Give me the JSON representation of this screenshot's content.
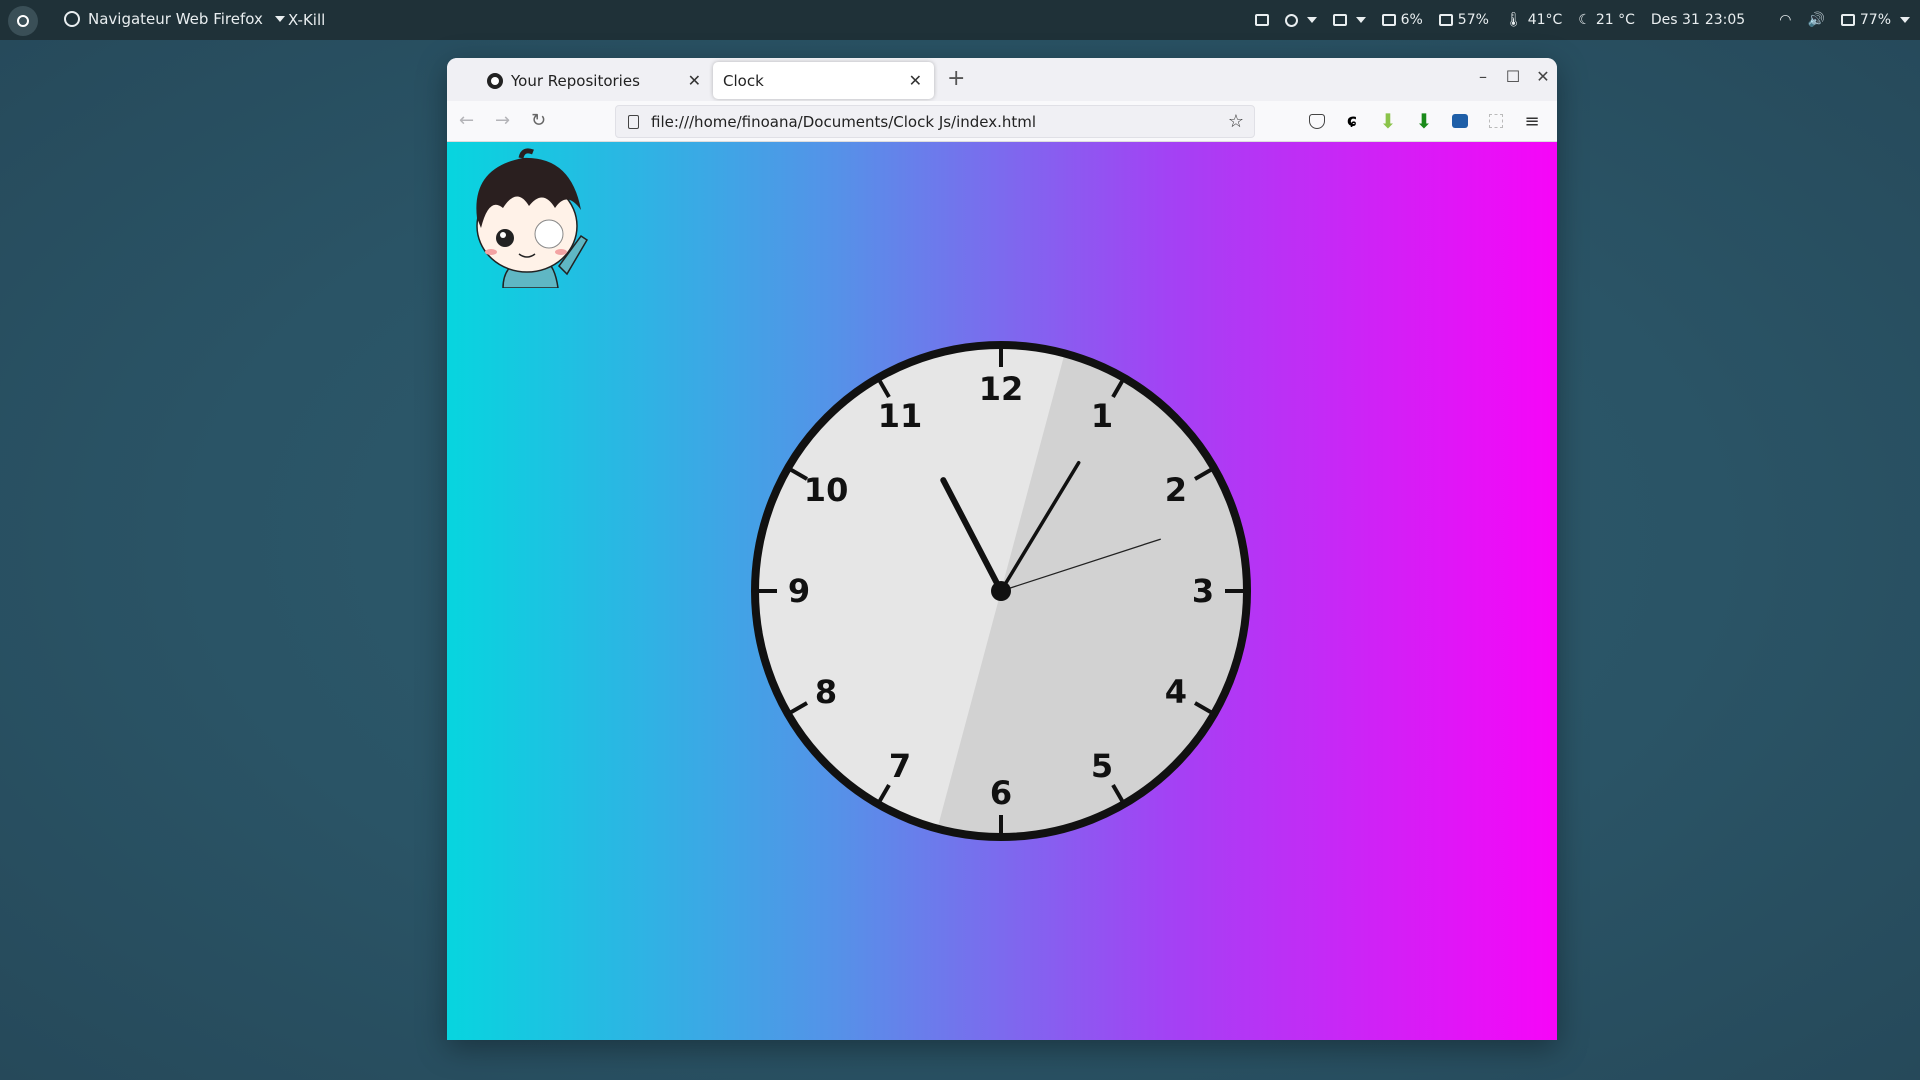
{
  "topbar": {
    "app_name": "Navigateur Web Firefox",
    "xkill": "X-Kill",
    "cpu": "6%",
    "memory": "57%",
    "cpu_temp": "41°C",
    "weather": "21 °C",
    "date": "Des 31",
    "time": "23:05",
    "battery": "77%"
  },
  "browser": {
    "tabs": [
      {
        "label": "Your Repositories",
        "icon": "github-icon",
        "active": false
      },
      {
        "label": "Clock",
        "icon": "none",
        "active": true
      }
    ],
    "new_tab": "+",
    "url": "file:///home/finoana/Documents/Clock Js/index.html"
  },
  "clock": {
    "numbers": [
      "12",
      "1",
      "2",
      "3",
      "4",
      "5",
      "6",
      "7",
      "8",
      "9",
      "10",
      "11"
    ],
    "hour": 11,
    "minute": 5,
    "second": 12,
    "face_color": "#e6e6e6",
    "shade_color": "#d2d2d2",
    "rim_color": "#111111"
  },
  "colors": {
    "gradient_start": "#07d5df",
    "gradient_end": "#f705f8"
  }
}
